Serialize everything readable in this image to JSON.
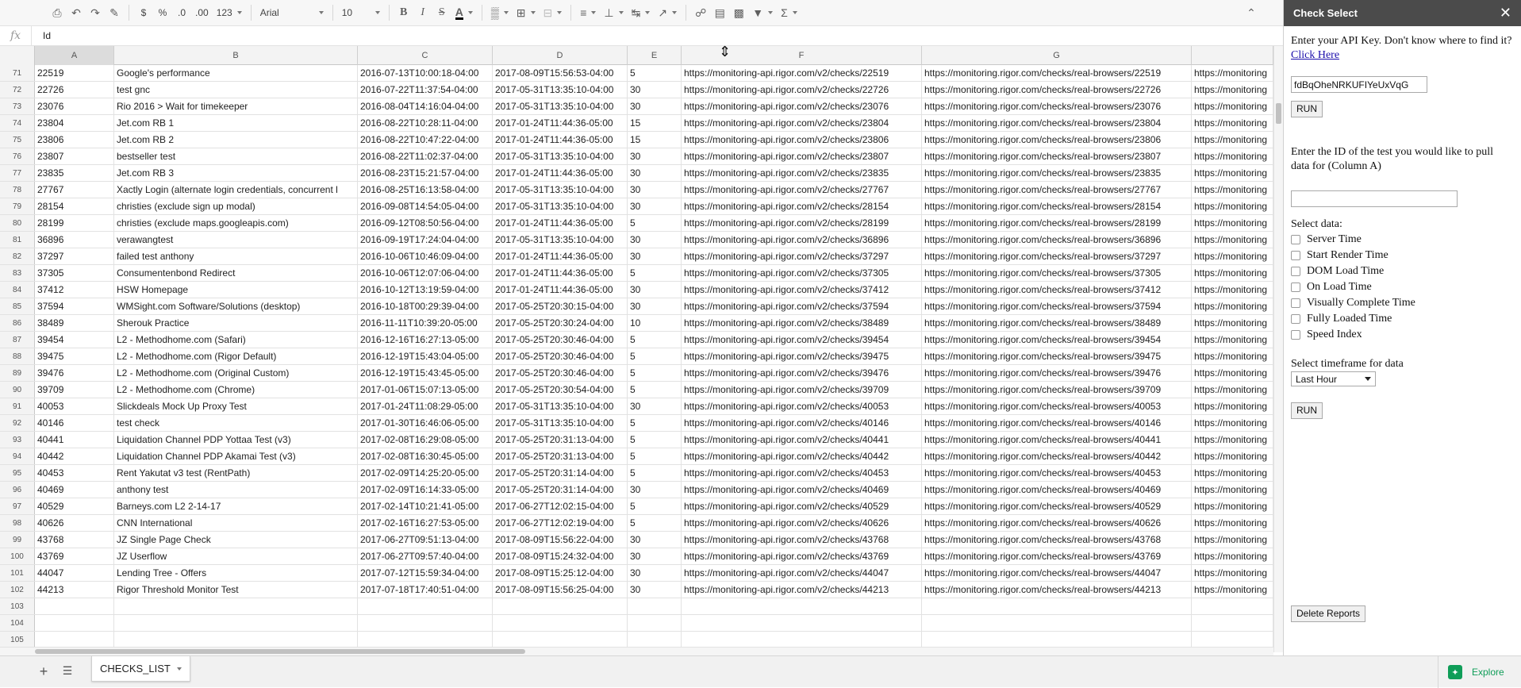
{
  "toolbar": {
    "font": "Arial",
    "font_size": "10",
    "zoom": "123",
    "currency": "$",
    "percent": "%",
    "dec_less": ".0",
    "dec_more": ".00"
  },
  "formula_bar": {
    "fx": "fx",
    "value": "Id"
  },
  "columns": [
    "A",
    "B",
    "C",
    "D",
    "E",
    "F",
    "G"
  ],
  "rows": [
    {
      "n": "71",
      "a": "22519",
      "b": "Google's performance",
      "c": "2016-07-13T10:00:18-04:00",
      "d": "2017-08-09T15:56:53-04:00",
      "e": "5",
      "f": "https://monitoring-api.rigor.com/v2/checks/22519",
      "g": "https://monitoring.rigor.com/checks/real-browsers/22519",
      "h": "https://monitoring"
    },
    {
      "n": "72",
      "a": "22726",
      "b": "test gnc",
      "c": "2016-07-22T11:37:54-04:00",
      "d": "2017-05-31T13:35:10-04:00",
      "e": "30",
      "f": "https://monitoring-api.rigor.com/v2/checks/22726",
      "g": "https://monitoring.rigor.com/checks/real-browsers/22726",
      "h": "https://monitoring"
    },
    {
      "n": "73",
      "a": "23076",
      "b": "Rio 2016 > Wait for timekeeper",
      "c": "2016-08-04T14:16:04-04:00",
      "d": "2017-05-31T13:35:10-04:00",
      "e": "30",
      "f": "https://monitoring-api.rigor.com/v2/checks/23076",
      "g": "https://monitoring.rigor.com/checks/real-browsers/23076",
      "h": "https://monitoring"
    },
    {
      "n": "74",
      "a": "23804",
      "b": "Jet.com RB 1",
      "c": "2016-08-22T10:28:11-04:00",
      "d": "2017-01-24T11:44:36-05:00",
      "e": "15",
      "f": "https://monitoring-api.rigor.com/v2/checks/23804",
      "g": "https://monitoring.rigor.com/checks/real-browsers/23804",
      "h": "https://monitoring"
    },
    {
      "n": "75",
      "a": "23806",
      "b": "Jet.com RB 2",
      "c": "2016-08-22T10:47:22-04:00",
      "d": "2017-01-24T11:44:36-05:00",
      "e": "15",
      "f": "https://monitoring-api.rigor.com/v2/checks/23806",
      "g": "https://monitoring.rigor.com/checks/real-browsers/23806",
      "h": "https://monitoring"
    },
    {
      "n": "76",
      "a": "23807",
      "b": "bestseller test",
      "c": "2016-08-22T11:02:37-04:00",
      "d": "2017-05-31T13:35:10-04:00",
      "e": "30",
      "f": "https://monitoring-api.rigor.com/v2/checks/23807",
      "g": "https://monitoring.rigor.com/checks/real-browsers/23807",
      "h": "https://monitoring"
    },
    {
      "n": "77",
      "a": "23835",
      "b": "Jet.com RB 3",
      "c": "2016-08-23T15:21:57-04:00",
      "d": "2017-01-24T11:44:36-05:00",
      "e": "30",
      "f": "https://monitoring-api.rigor.com/v2/checks/23835",
      "g": "https://monitoring.rigor.com/checks/real-browsers/23835",
      "h": "https://monitoring"
    },
    {
      "n": "78",
      "a": "27767",
      "b": "Xactly Login (alternate login credentials, concurrent l",
      "c": "2016-08-25T16:13:58-04:00",
      "d": "2017-05-31T13:35:10-04:00",
      "e": "30",
      "f": "https://monitoring-api.rigor.com/v2/checks/27767",
      "g": "https://monitoring.rigor.com/checks/real-browsers/27767",
      "h": "https://monitoring"
    },
    {
      "n": "79",
      "a": "28154",
      "b": "christies (exclude sign up modal)",
      "c": "2016-09-08T14:54:05-04:00",
      "d": "2017-05-31T13:35:10-04:00",
      "e": "30",
      "f": "https://monitoring-api.rigor.com/v2/checks/28154",
      "g": "https://monitoring.rigor.com/checks/real-browsers/28154",
      "h": "https://monitoring"
    },
    {
      "n": "80",
      "a": "28199",
      "b": "christies (exclude maps.googleapis.com)",
      "c": "2016-09-12T08:50:56-04:00",
      "d": "2017-01-24T11:44:36-05:00",
      "e": "5",
      "f": "https://monitoring-api.rigor.com/v2/checks/28199",
      "g": "https://monitoring.rigor.com/checks/real-browsers/28199",
      "h": "https://monitoring"
    },
    {
      "n": "81",
      "a": "36896",
      "b": "verawangtest",
      "c": "2016-09-19T17:24:04-04:00",
      "d": "2017-05-31T13:35:10-04:00",
      "e": "30",
      "f": "https://monitoring-api.rigor.com/v2/checks/36896",
      "g": "https://monitoring.rigor.com/checks/real-browsers/36896",
      "h": "https://monitoring"
    },
    {
      "n": "82",
      "a": "37297",
      "b": "failed test anthony",
      "c": "2016-10-06T10:46:09-04:00",
      "d": "2017-01-24T11:44:36-05:00",
      "e": "30",
      "f": "https://monitoring-api.rigor.com/v2/checks/37297",
      "g": "https://monitoring.rigor.com/checks/real-browsers/37297",
      "h": "https://monitoring"
    },
    {
      "n": "83",
      "a": "37305",
      "b": "Consumentenbond Redirect",
      "c": "2016-10-06T12:07:06-04:00",
      "d": "2017-01-24T11:44:36-05:00",
      "e": "5",
      "f": "https://monitoring-api.rigor.com/v2/checks/37305",
      "g": "https://monitoring.rigor.com/checks/real-browsers/37305",
      "h": "https://monitoring"
    },
    {
      "n": "84",
      "a": "37412",
      "b": "HSW Homepage",
      "c": "2016-10-12T13:19:59-04:00",
      "d": "2017-01-24T11:44:36-05:00",
      "e": "30",
      "f": "https://monitoring-api.rigor.com/v2/checks/37412",
      "g": "https://monitoring.rigor.com/checks/real-browsers/37412",
      "h": "https://monitoring"
    },
    {
      "n": "85",
      "a": "37594",
      "b": "WMSight.com Software/Solutions (desktop)",
      "c": "2016-10-18T00:29:39-04:00",
      "d": "2017-05-25T20:30:15-04:00",
      "e": "30",
      "f": "https://monitoring-api.rigor.com/v2/checks/37594",
      "g": "https://monitoring.rigor.com/checks/real-browsers/37594",
      "h": "https://monitoring"
    },
    {
      "n": "86",
      "a": "38489",
      "b": "Sherouk Practice",
      "c": "2016-11-11T10:39:20-05:00",
      "d": "2017-05-25T20:30:24-04:00",
      "e": "10",
      "f": "https://monitoring-api.rigor.com/v2/checks/38489",
      "g": "https://monitoring.rigor.com/checks/real-browsers/38489",
      "h": "https://monitoring"
    },
    {
      "n": "87",
      "a": "39454",
      "b": "L2 - Methodhome.com (Safari)",
      "c": "2016-12-16T16:27:13-05:00",
      "d": "2017-05-25T20:30:46-04:00",
      "e": "5",
      "f": "https://monitoring-api.rigor.com/v2/checks/39454",
      "g": "https://monitoring.rigor.com/checks/real-browsers/39454",
      "h": "https://monitoring"
    },
    {
      "n": "88",
      "a": "39475",
      "b": "L2 - Methodhome.com (Rigor Default)",
      "c": "2016-12-19T15:43:04-05:00",
      "d": "2017-05-25T20:30:46-04:00",
      "e": "5",
      "f": "https://monitoring-api.rigor.com/v2/checks/39475",
      "g": "https://monitoring.rigor.com/checks/real-browsers/39475",
      "h": "https://monitoring"
    },
    {
      "n": "89",
      "a": "39476",
      "b": "L2 - Methodhome.com (Original Custom)",
      "c": "2016-12-19T15:43:45-05:00",
      "d": "2017-05-25T20:30:46-04:00",
      "e": "5",
      "f": "https://monitoring-api.rigor.com/v2/checks/39476",
      "g": "https://monitoring.rigor.com/checks/real-browsers/39476",
      "h": "https://monitoring"
    },
    {
      "n": "90",
      "a": "39709",
      "b": "L2 - Methodhome.com (Chrome)",
      "c": "2017-01-06T15:07:13-05:00",
      "d": "2017-05-25T20:30:54-04:00",
      "e": "5",
      "f": "https://monitoring-api.rigor.com/v2/checks/39709",
      "g": "https://monitoring.rigor.com/checks/real-browsers/39709",
      "h": "https://monitoring"
    },
    {
      "n": "91",
      "a": "40053",
      "b": "Slickdeals Mock Up Proxy Test",
      "c": "2017-01-24T11:08:29-05:00",
      "d": "2017-05-31T13:35:10-04:00",
      "e": "30",
      "f": "https://monitoring-api.rigor.com/v2/checks/40053",
      "g": "https://monitoring.rigor.com/checks/real-browsers/40053",
      "h": "https://monitoring"
    },
    {
      "n": "92",
      "a": "40146",
      "b": "test check",
      "c": "2017-01-30T16:46:06-05:00",
      "d": "2017-05-31T13:35:10-04:00",
      "e": "5",
      "f": "https://monitoring-api.rigor.com/v2/checks/40146",
      "g": "https://monitoring.rigor.com/checks/real-browsers/40146",
      "h": "https://monitoring"
    },
    {
      "n": "93",
      "a": "40441",
      "b": "Liquidation Channel PDP Yottaa Test (v3)",
      "c": "2017-02-08T16:29:08-05:00",
      "d": "2017-05-25T20:31:13-04:00",
      "e": "5",
      "f": "https://monitoring-api.rigor.com/v2/checks/40441",
      "g": "https://monitoring.rigor.com/checks/real-browsers/40441",
      "h": "https://monitoring"
    },
    {
      "n": "94",
      "a": "40442",
      "b": "Liquidation Channel PDP Akamai Test (v3)",
      "c": "2017-02-08T16:30:45-05:00",
      "d": "2017-05-25T20:31:13-04:00",
      "e": "5",
      "f": "https://monitoring-api.rigor.com/v2/checks/40442",
      "g": "https://monitoring.rigor.com/checks/real-browsers/40442",
      "h": "https://monitoring"
    },
    {
      "n": "95",
      "a": "40453",
      "b": "Rent Yakutat v3 test (RentPath)",
      "c": "2017-02-09T14:25:20-05:00",
      "d": "2017-05-25T20:31:14-04:00",
      "e": "5",
      "f": "https://monitoring-api.rigor.com/v2/checks/40453",
      "g": "https://monitoring.rigor.com/checks/real-browsers/40453",
      "h": "https://monitoring"
    },
    {
      "n": "96",
      "a": "40469",
      "b": "anthony test",
      "c": "2017-02-09T16:14:33-05:00",
      "d": "2017-05-25T20:31:14-04:00",
      "e": "30",
      "f": "https://monitoring-api.rigor.com/v2/checks/40469",
      "g": "https://monitoring.rigor.com/checks/real-browsers/40469",
      "h": "https://monitoring"
    },
    {
      "n": "97",
      "a": "40529",
      "b": "Barneys.com L2 2-14-17",
      "c": "2017-02-14T10:21:41-05:00",
      "d": "2017-06-27T12:02:15-04:00",
      "e": "5",
      "f": "https://monitoring-api.rigor.com/v2/checks/40529",
      "g": "https://monitoring.rigor.com/checks/real-browsers/40529",
      "h": "https://monitoring"
    },
    {
      "n": "98",
      "a": "40626",
      "b": "CNN International",
      "c": "2017-02-16T16:27:53-05:00",
      "d": "2017-06-27T12:02:19-04:00",
      "e": "5",
      "f": "https://monitoring-api.rigor.com/v2/checks/40626",
      "g": "https://monitoring.rigor.com/checks/real-browsers/40626",
      "h": "https://monitoring"
    },
    {
      "n": "99",
      "a": "43768",
      "b": "JZ Single Page Check",
      "c": "2017-06-27T09:51:13-04:00",
      "d": "2017-08-09T15:56:22-04:00",
      "e": "30",
      "f": "https://monitoring-api.rigor.com/v2/checks/43768",
      "g": "https://monitoring.rigor.com/checks/real-browsers/43768",
      "h": "https://monitoring"
    },
    {
      "n": "100",
      "a": "43769",
      "b": "JZ Userflow",
      "c": "2017-06-27T09:57:40-04:00",
      "d": "2017-08-09T15:24:32-04:00",
      "e": "30",
      "f": "https://monitoring-api.rigor.com/v2/checks/43769",
      "g": "https://monitoring.rigor.com/checks/real-browsers/43769",
      "h": "https://monitoring"
    },
    {
      "n": "101",
      "a": "44047",
      "b": "Lending Tree - Offers",
      "c": "2017-07-12T15:59:34-04:00",
      "d": "2017-08-09T15:25:12-04:00",
      "e": "30",
      "f": "https://monitoring-api.rigor.com/v2/checks/44047",
      "g": "https://monitoring.rigor.com/checks/real-browsers/44047",
      "h": "https://monitoring"
    },
    {
      "n": "102",
      "a": "44213",
      "b": "Rigor Threshold Monitor Test",
      "c": "2017-07-18T17:40:51-04:00",
      "d": "2017-08-09T15:56:25-04:00",
      "e": "30",
      "f": "https://monitoring-api.rigor.com/v2/checks/44213",
      "g": "https://monitoring.rigor.com/checks/real-browsers/44213",
      "h": "https://monitoring"
    },
    {
      "n": "103",
      "a": "",
      "b": "",
      "c": "",
      "d": "",
      "e": "",
      "f": "",
      "g": "",
      "h": ""
    },
    {
      "n": "104",
      "a": "",
      "b": "",
      "c": "",
      "d": "",
      "e": "",
      "f": "",
      "g": "",
      "h": ""
    },
    {
      "n": "105",
      "a": "",
      "b": "",
      "c": "",
      "d": "",
      "e": "",
      "f": "",
      "g": "",
      "h": ""
    }
  ],
  "sheet_tab": {
    "label": "CHECKS_LIST"
  },
  "explore": {
    "label": "Explore"
  },
  "sidebar": {
    "title": "Check Select",
    "api_prompt": "Enter your API Key. Don't know where to find it?",
    "api_link": "Click Here",
    "api_key_value": "fdBqOheNRKUFIYeUxVqG",
    "run_label": "RUN",
    "id_prompt": "Enter the ID of the test you would like to pull data for (Column A)",
    "id_value": "",
    "select_data_label": "Select data:",
    "options": [
      "Server Time",
      "Start Render Time",
      "DOM Load Time",
      "On Load Time",
      "Visually Complete Time",
      "Fully Loaded Time",
      "Speed Index"
    ],
    "timeframe_label": "Select timeframe for data",
    "timeframe_value": "Last Hour",
    "run2_label": "RUN",
    "delete_label": "Delete Reports"
  }
}
